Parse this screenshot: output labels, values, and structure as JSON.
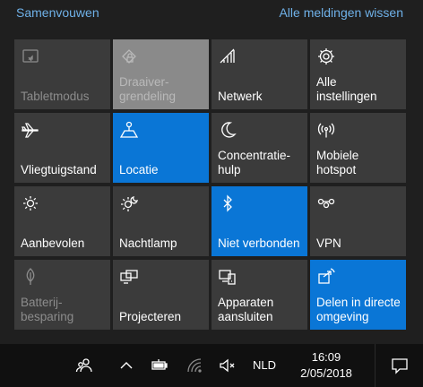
{
  "header": {
    "collapse_label": "Samenvouwen",
    "all_notifications_label": "Alle meldingen wissen"
  },
  "tiles": [
    {
      "lines": [
        "Tabletmodus"
      ],
      "icon": "tablet-mode-icon",
      "state": "disabled"
    },
    {
      "lines": [
        "Draaiver-",
        "grendeling"
      ],
      "icon": "rotation-lock-icon",
      "state": "disabled-light"
    },
    {
      "lines": [
        "Netwerk"
      ],
      "icon": "network-icon",
      "state": "off"
    },
    {
      "lines": [
        "Alle",
        "instellingen"
      ],
      "icon": "gear-icon",
      "state": "off"
    },
    {
      "lines": [
        "Vliegtuigstand"
      ],
      "icon": "airplane-icon",
      "state": "off"
    },
    {
      "lines": [
        "Locatie"
      ],
      "icon": "location-icon",
      "state": "on"
    },
    {
      "lines": [
        "Concentratie-",
        "hulp"
      ],
      "icon": "moon-icon",
      "state": "off"
    },
    {
      "lines": [
        "Mobiele",
        "hotspot"
      ],
      "icon": "hotspot-icon",
      "state": "off"
    },
    {
      "lines": [
        "Aanbevolen"
      ],
      "icon": "brightness-icon",
      "state": "off"
    },
    {
      "lines": [
        "Nachtlamp"
      ],
      "icon": "night-light-icon",
      "state": "off"
    },
    {
      "lines": [
        "Niet verbonden"
      ],
      "icon": "bluetooth-icon",
      "state": "on"
    },
    {
      "lines": [
        "VPN"
      ],
      "icon": "vpn-icon",
      "state": "off"
    },
    {
      "lines": [
        "Batterij-",
        "besparing"
      ],
      "icon": "battery-saver-icon",
      "state": "disabled"
    },
    {
      "lines": [
        "Projecteren"
      ],
      "icon": "project-icon",
      "state": "off"
    },
    {
      "lines": [
        "Apparaten",
        "aansluiten"
      ],
      "icon": "connect-icon",
      "state": "off"
    },
    {
      "lines": [
        "Delen in directe",
        "omgeving"
      ],
      "icon": "nearby-share-icon",
      "state": "on"
    }
  ],
  "taskbar": {
    "language": "NLD",
    "time": "16:09",
    "date": "2/05/2018",
    "icons": [
      "people-icon",
      "chevron-up-icon",
      "battery-icon",
      "wifi-icon",
      "volume-muted-icon",
      "action-center-icon"
    ]
  },
  "colors": {
    "accent": "#0a76d6",
    "tile": "#3b3b3b",
    "link": "#6fb1e8",
    "background": "#1f1f1f",
    "taskbar": "#101010"
  }
}
